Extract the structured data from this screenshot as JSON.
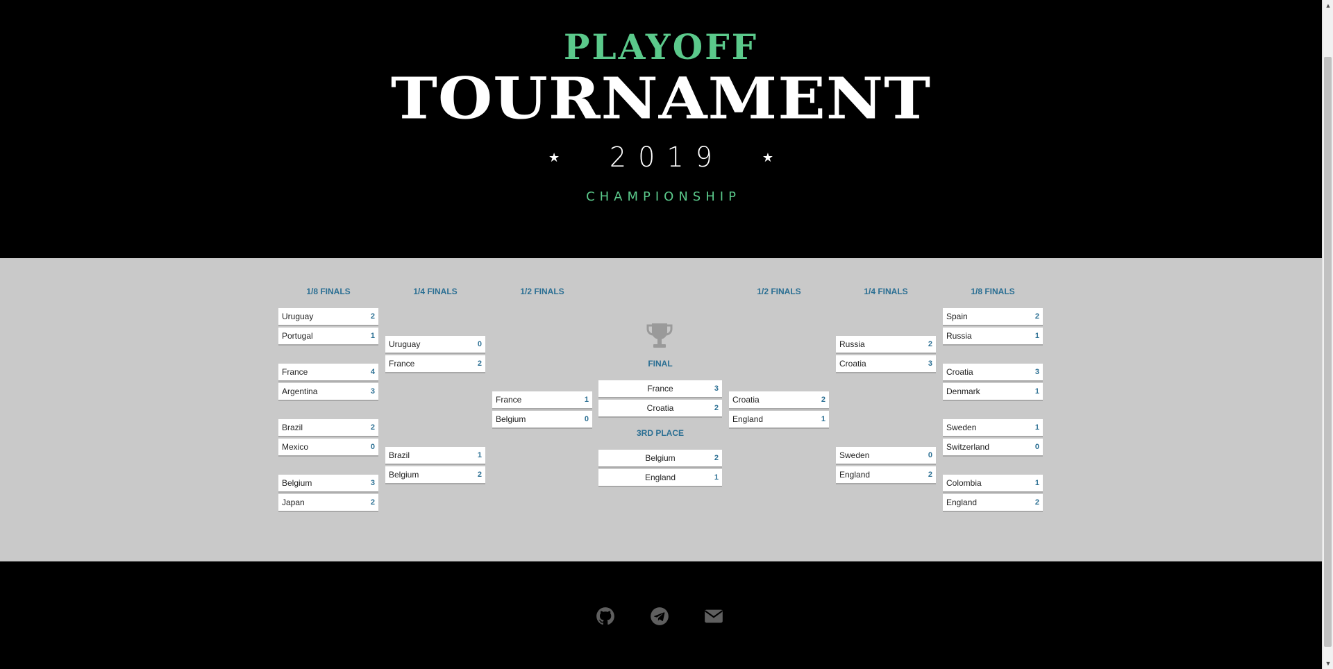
{
  "hero": {
    "eyebrow": "PLAYOFF",
    "title": "TOURNAMENT",
    "year": "2019",
    "subtitle": "CHAMPIONSHIP",
    "star_icon": "star-icon"
  },
  "colors": {
    "accent_green": "#5bc98b",
    "score_blue": "#2b6f93",
    "bracket_bg": "#c9c9c9"
  },
  "rounds": {
    "left_r16": "1/8 FINALS",
    "left_qf": "1/4 FINALS",
    "left_sf": "1/2 FINALS",
    "right_sf": "1/2 FINALS",
    "right_qf": "1/4 FINALS",
    "right_r16": "1/8 FINALS"
  },
  "left": {
    "r16": [
      {
        "teams": [
          {
            "name": "Uruguay",
            "score": "2"
          },
          {
            "name": "Portugal",
            "score": "1"
          }
        ]
      },
      {
        "teams": [
          {
            "name": "France",
            "score": "4"
          },
          {
            "name": "Argentina",
            "score": "3"
          }
        ]
      },
      {
        "teams": [
          {
            "name": "Brazil",
            "score": "2"
          },
          {
            "name": "Mexico",
            "score": "0"
          }
        ]
      },
      {
        "teams": [
          {
            "name": "Belgium",
            "score": "3"
          },
          {
            "name": "Japan",
            "score": "2"
          }
        ]
      }
    ],
    "qf": [
      {
        "teams": [
          {
            "name": "Uruguay",
            "score": "0"
          },
          {
            "name": "France",
            "score": "2"
          }
        ]
      },
      {
        "teams": [
          {
            "name": "Brazil",
            "score": "1"
          },
          {
            "name": "Belgium",
            "score": "2"
          }
        ]
      }
    ],
    "sf": [
      {
        "teams": [
          {
            "name": "France",
            "score": "1"
          },
          {
            "name": "Belgium",
            "score": "0"
          }
        ]
      }
    ]
  },
  "right": {
    "r16": [
      {
        "teams": [
          {
            "name": "Spain",
            "score": "2"
          },
          {
            "name": "Russia",
            "score": "1"
          }
        ]
      },
      {
        "teams": [
          {
            "name": "Croatia",
            "score": "3"
          },
          {
            "name": "Denmark",
            "score": "1"
          }
        ]
      },
      {
        "teams": [
          {
            "name": "Sweden",
            "score": "1"
          },
          {
            "name": "Switzerland",
            "score": "0"
          }
        ]
      },
      {
        "teams": [
          {
            "name": "Colombia",
            "score": "1"
          },
          {
            "name": "England",
            "score": "2"
          }
        ]
      }
    ],
    "qf": [
      {
        "teams": [
          {
            "name": "Russia",
            "score": "2"
          },
          {
            "name": "Croatia",
            "score": "3"
          }
        ]
      },
      {
        "teams": [
          {
            "name": "Sweden",
            "score": "0"
          },
          {
            "name": "England",
            "score": "2"
          }
        ]
      }
    ],
    "sf": [
      {
        "teams": [
          {
            "name": "Croatia",
            "score": "2"
          },
          {
            "name": "England",
            "score": "1"
          }
        ]
      }
    ]
  },
  "center": {
    "trophy_icon": "trophy-icon",
    "final_label": "FINAL",
    "final": {
      "teams": [
        {
          "name": "France",
          "score": "3"
        },
        {
          "name": "Croatia",
          "score": "2"
        }
      ]
    },
    "third_label": "3RD PLACE",
    "third": {
      "teams": [
        {
          "name": "Belgium",
          "score": "2"
        },
        {
          "name": "England",
          "score": "1"
        }
      ]
    }
  },
  "footer": {
    "icons": [
      "github-icon",
      "telegram-icon",
      "envelope-icon"
    ]
  }
}
